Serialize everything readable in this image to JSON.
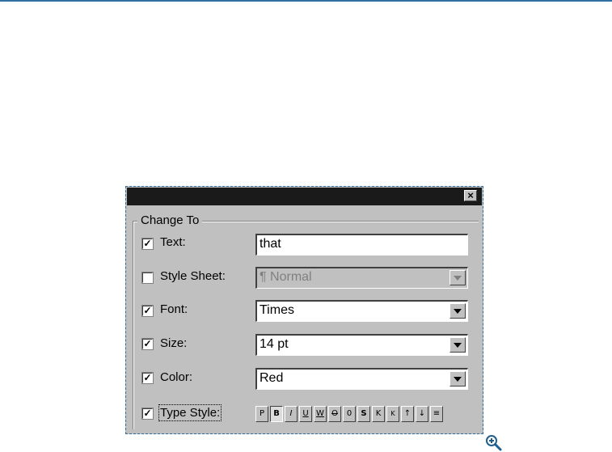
{
  "dialog": {
    "close_label": "×",
    "group_title": "Change To",
    "rows": {
      "text": {
        "label": "Text:",
        "checked": true,
        "value": "that"
      },
      "style_sheet": {
        "label": "Style Sheet:",
        "checked": false,
        "value": "¶ Normal",
        "disabled": true
      },
      "font": {
        "label": "Font:",
        "checked": true,
        "value": "Times"
      },
      "size": {
        "label": "Size:",
        "checked": true,
        "value": "14 pt"
      },
      "color": {
        "label": "Color:",
        "checked": true,
        "value": "Red"
      },
      "type_style": {
        "label": "Type Style:",
        "checked": true
      }
    },
    "type_style_buttons": [
      "P",
      "B",
      "I",
      "U",
      "W",
      "O",
      "0",
      "S",
      "K",
      "K",
      "↑",
      "↓",
      "≡"
    ],
    "checkmark": "✓"
  },
  "colors": {
    "title_bar": "#1a1a1a",
    "dialog_bg": "#c0c0c0",
    "accent_rule": "#2f6f9f"
  },
  "icons": {
    "zoom": "zoom-in-icon"
  }
}
